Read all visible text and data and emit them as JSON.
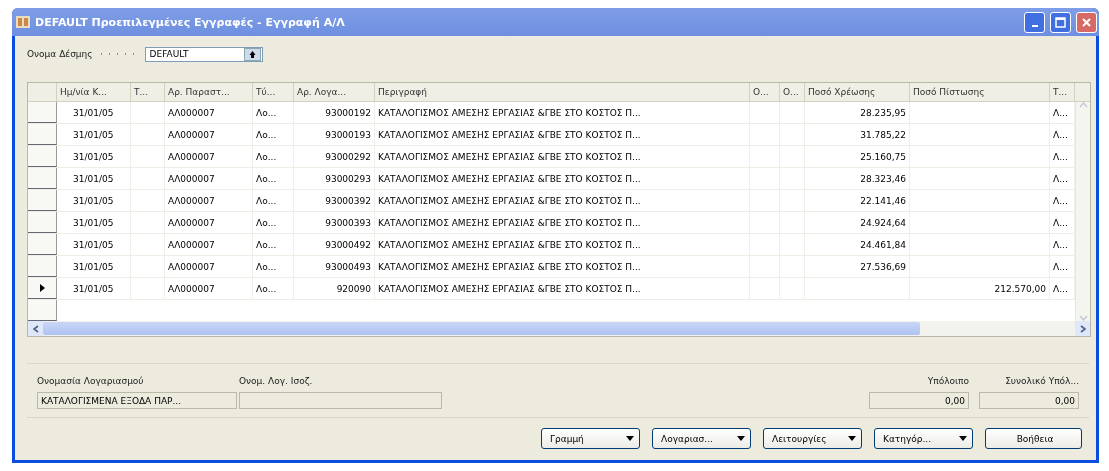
{
  "window": {
    "title": "DEFAULT Προεπιλεγμένες Εγγραφές - Εγγραφή Α/Λ"
  },
  "batch": {
    "label": "Ονομα Δέσμης",
    "value": "DEFAULT"
  },
  "table": {
    "columns": [
      "Ημ/νία Κ...",
      "Τ...",
      "Αρ. Παραστ...",
      "Τύ...",
      "Αρ. Λογα...",
      "Περιγραφή",
      "Ο...",
      "Ο...",
      "Ποσό Χρέωσης",
      "Ποσό Πίστωσης",
      "Τ..."
    ],
    "rows": [
      {
        "selected": false,
        "cells": [
          "31/01/05",
          "",
          "ΑΛ000007",
          "Λο...",
          "93000192",
          "ΚΑΤΑΛΟΓΙΣΜΟΣ ΑΜΕΣΗΣ ΕΡΓΑΣΙΑΣ &ΓΒΕ ΣΤΟ ΚΟΣΤΟΣ Π...",
          "",
          "",
          "28.235,95",
          "",
          "Λ..."
        ]
      },
      {
        "selected": false,
        "cells": [
          "31/01/05",
          "",
          "ΑΛ000007",
          "Λο...",
          "93000193",
          "ΚΑΤΑΛΟΓΙΣΜΟΣ ΑΜΕΣΗΣ ΕΡΓΑΣΙΑΣ &ΓΒΕ ΣΤΟ ΚΟΣΤΟΣ Π...",
          "",
          "",
          "31.785,22",
          "",
          "Λ..."
        ]
      },
      {
        "selected": false,
        "cells": [
          "31/01/05",
          "",
          "ΑΛ000007",
          "Λο...",
          "93000292",
          "ΚΑΤΑΛΟΓΙΣΜΟΣ ΑΜΕΣΗΣ ΕΡΓΑΣΙΑΣ &ΓΒΕ ΣΤΟ ΚΟΣΤΟΣ Π...",
          "",
          "",
          "25.160,75",
          "",
          "Λ..."
        ]
      },
      {
        "selected": false,
        "cells": [
          "31/01/05",
          "",
          "ΑΛ000007",
          "Λο...",
          "93000293",
          "ΚΑΤΑΛΟΓΙΣΜΟΣ ΑΜΕΣΗΣ ΕΡΓΑΣΙΑΣ &ΓΒΕ ΣΤΟ ΚΟΣΤΟΣ Π...",
          "",
          "",
          "28.323,46",
          "",
          "Λ..."
        ]
      },
      {
        "selected": false,
        "cells": [
          "31/01/05",
          "",
          "ΑΛ000007",
          "Λο...",
          "93000392",
          "ΚΑΤΑΛΟΓΙΣΜΟΣ ΑΜΕΣΗΣ ΕΡΓΑΣΙΑΣ &ΓΒΕ ΣΤΟ ΚΟΣΤΟΣ Π...",
          "",
          "",
          "22.141,46",
          "",
          "Λ..."
        ]
      },
      {
        "selected": false,
        "cells": [
          "31/01/05",
          "",
          "ΑΛ000007",
          "Λο...",
          "93000393",
          "ΚΑΤΑΛΟΓΙΣΜΟΣ ΑΜΕΣΗΣ ΕΡΓΑΣΙΑΣ &ΓΒΕ ΣΤΟ ΚΟΣΤΟΣ Π...",
          "",
          "",
          "24.924,64",
          "",
          "Λ..."
        ]
      },
      {
        "selected": false,
        "cells": [
          "31/01/05",
          "",
          "ΑΛ000007",
          "Λο...",
          "93000492",
          "ΚΑΤΑΛΟΓΙΣΜΟΣ ΑΜΕΣΗΣ ΕΡΓΑΣΙΑΣ &ΓΒΕ ΣΤΟ ΚΟΣΤΟΣ Π...",
          "",
          "",
          "24.461,84",
          "",
          "Λ..."
        ]
      },
      {
        "selected": false,
        "cells": [
          "31/01/05",
          "",
          "ΑΛ000007",
          "Λο...",
          "93000493",
          "ΚΑΤΑΛΟΓΙΣΜΟΣ ΑΜΕΣΗΣ ΕΡΓΑΣΙΑΣ &ΓΒΕ ΣΤΟ ΚΟΣΤΟΣ Π...",
          "",
          "",
          "27.536,69",
          "",
          "Λ..."
        ]
      },
      {
        "selected": true,
        "cells": [
          "31/01/05",
          "",
          "ΑΛ000007",
          "Λο...",
          "920090",
          "ΚΑΤΑΛΟΓΙΣΜΟΣ ΑΜΕΣΗΣ ΕΡΓΑΣΙΑΣ &ΓΒΕ ΣΤΟ ΚΟΣΤΟΣ Π...",
          "",
          "",
          "",
          "212.570,00",
          "Λ..."
        ]
      }
    ]
  },
  "info": [
    {
      "label": "Ονομασία Λογαριασμού",
      "value": "ΚΑΤΑΛΟΓΙΣΜΕΝΑ ΕΞΟΔΑ ΠΑΡ..."
    },
    {
      "label": "Ονομ. Λογ. Ισοζ."
    }
  ],
  "totals": [
    {
      "label": "Υπόλοιπο",
      "value": "0,00"
    },
    {
      "label": "Συνολικό Υπόλ...",
      "value": "0,00"
    }
  ],
  "buttons": [
    {
      "label": "Γραμμή",
      "kind": "menu"
    },
    {
      "label": "Λογαριασ...",
      "kind": "menu"
    },
    {
      "label": "Λειτουργίες",
      "kind": "menu"
    },
    {
      "label": "Κατηγόρ...",
      "kind": "menu"
    },
    {
      "label": "Βοήθεια",
      "kind": "plain"
    }
  ]
}
